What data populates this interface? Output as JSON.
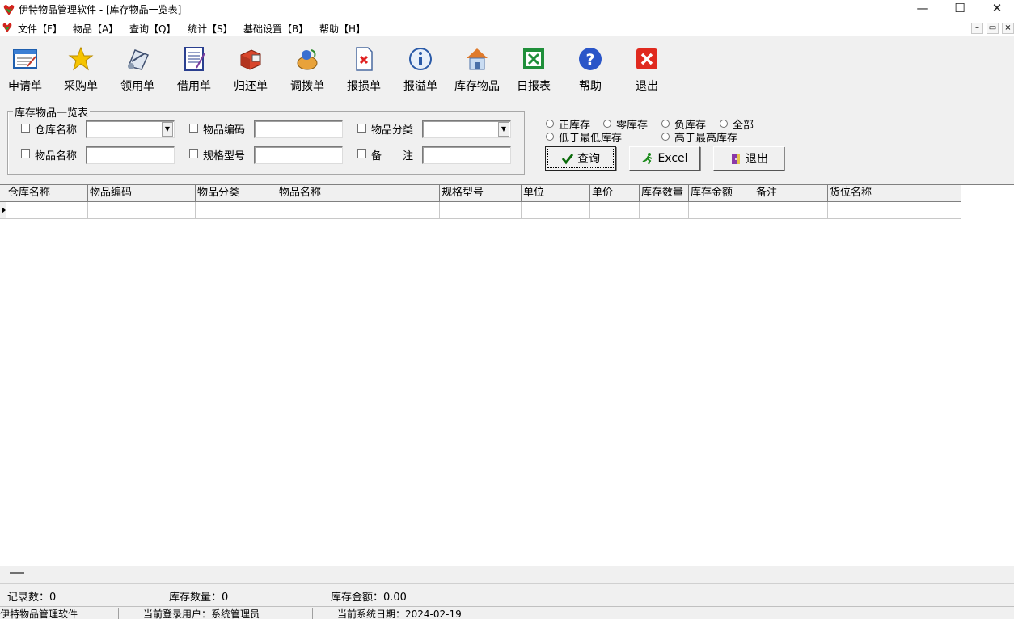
{
  "window": {
    "title": "伊特物品管理软件 - [库存物品一览表]",
    "minimize": "—",
    "maximize": "☐",
    "close": "✕"
  },
  "menu": {
    "items": [
      "文件【F】",
      "物品【A】",
      "查询【Q】",
      "统计【S】",
      "基础设置【B】",
      "帮助【H】"
    ],
    "mdi_min": "–",
    "mdi_restore": "▭",
    "mdi_close": "×"
  },
  "toolbar": {
    "items": [
      {
        "label": "申请单",
        "icon": "application-form-icon"
      },
      {
        "label": "采购单",
        "icon": "star-icon"
      },
      {
        "label": "领用单",
        "icon": "receive-icon"
      },
      {
        "label": "借用单",
        "icon": "notebook-icon"
      },
      {
        "label": "归还单",
        "icon": "return-box-icon"
      },
      {
        "label": "调拨单",
        "icon": "transfer-icon"
      },
      {
        "label": "报损单",
        "icon": "damage-report-icon"
      },
      {
        "label": "报溢单",
        "icon": "info-icon"
      },
      {
        "label": "库存物品",
        "icon": "home-icon"
      },
      {
        "label": "日报表",
        "icon": "excel-icon"
      },
      {
        "label": "帮助",
        "icon": "help-icon"
      },
      {
        "label": "退出",
        "icon": "exit-icon"
      }
    ]
  },
  "filters": {
    "group_title": "库存物品一览表",
    "warehouse_label": "仓库名称",
    "item_code_label": "物品编码",
    "category_label": "物品分类",
    "item_name_label": "物品名称",
    "spec_label": "规格型号",
    "remark_label": "备　　注",
    "warehouse_value": "",
    "item_code_value": "",
    "category_value": "",
    "item_name_value": "",
    "spec_value": "",
    "remark_value": ""
  },
  "stock_options": {
    "positive": "正库存",
    "zero": "零库存",
    "negative": "负库存",
    "all": "全部",
    "below_min": "低于最低库存",
    "above_max": "高于最高库存"
  },
  "actions": {
    "query": "查询",
    "excel": "Excel",
    "exit": "退出"
  },
  "grid": {
    "columns": [
      "仓库名称",
      "物品编码",
      "物品分类",
      "物品名称",
      "规格型号",
      "单位",
      "单价",
      "库存数量",
      "库存金额",
      "备注",
      "货位名称"
    ]
  },
  "summary": {
    "record_count": "记录数：0",
    "stock_qty": "库存数量：0",
    "stock_amount": "库存金额：0.00"
  },
  "status": {
    "app_name": "伊特物品管理软件",
    "user_label": "当前登录用户：",
    "user_value": "系统管理员",
    "date_label": "当前系统日期：",
    "date_value": "2024-02-19"
  }
}
